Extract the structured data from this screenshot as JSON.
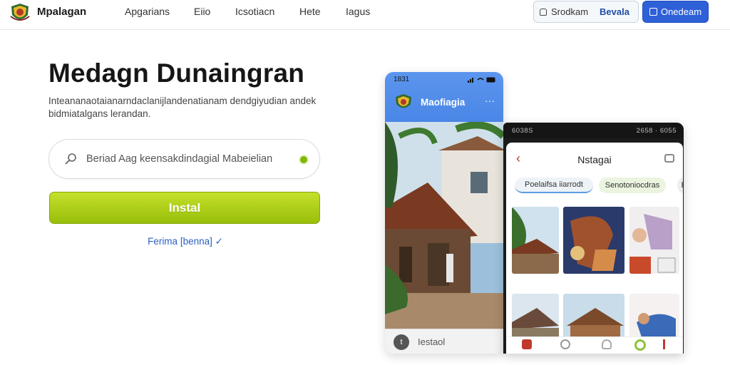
{
  "nav": {
    "brand": "Mpalagan",
    "links": [
      "Apgarians",
      "Eiio",
      "Icsotiacn",
      "Hete",
      "Iagus"
    ],
    "signin_label": "Srodkam",
    "secondary_label": "Bevala",
    "primary_label": "Onedeam"
  },
  "hero": {
    "title": "Medagn Dunaingran",
    "subtitle": "Inteananaotaianarndaclanijlandenatianam dendgiyudian andek bidmiatalgans lerandan.",
    "search_placeholder": "Beriad Aag keensakdindagial Mabeielian",
    "install_label": "Instal",
    "learn_more": "Ferima [benna] ✓"
  },
  "phone1": {
    "time": "1831",
    "app_name": "Maofiagia",
    "bottom_text": "Iestaol",
    "avatar_letter": "t"
  },
  "phone2": {
    "status_left": "6038S",
    "status_right": "2658 · 6055",
    "title": "Nstagai",
    "chips": [
      "Poelaifsa iiarrodt",
      "Senotoniocdras",
      "bi"
    ]
  },
  "colors": {
    "accent_blue": "#2f60d8",
    "install_green": "#98bf0a",
    "link_blue": "#2c5fc0",
    "phone_header_blue": "#4a86e6"
  }
}
